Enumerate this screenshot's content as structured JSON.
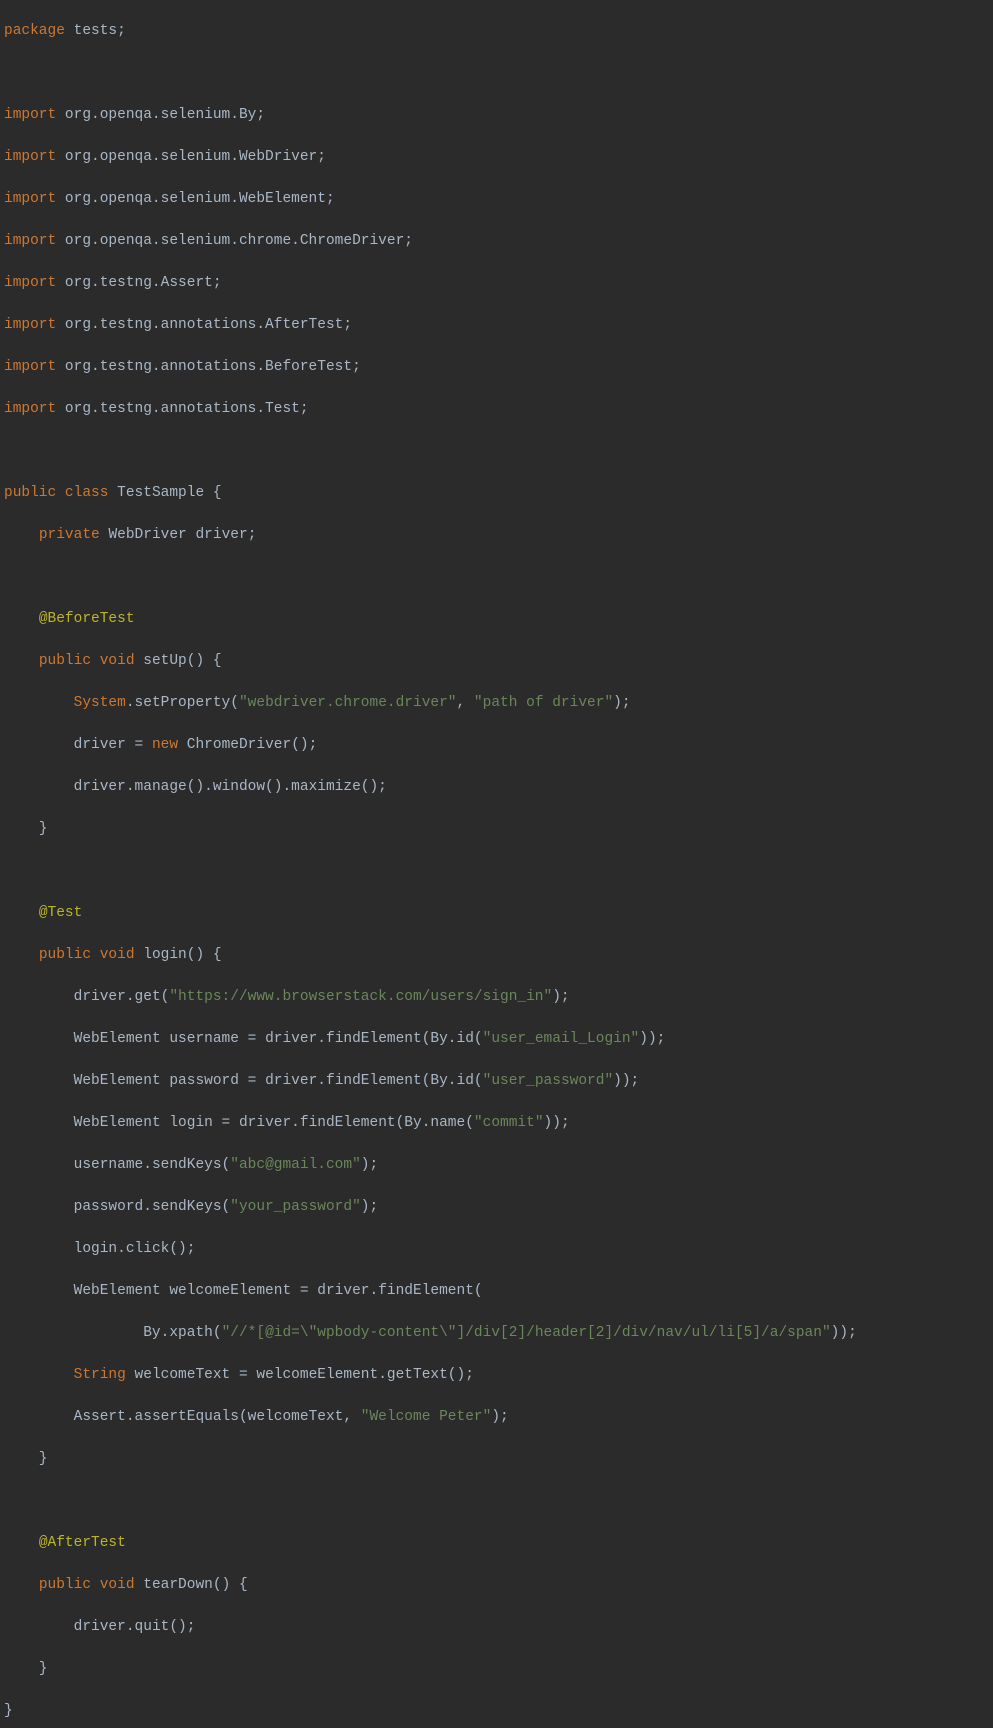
{
  "code": {
    "package_kw": "package",
    "package_name": "tests",
    "import_kw": "import",
    "imports": [
      "org.openqa.selenium.By",
      "org.openqa.selenium.WebDriver",
      "org.openqa.selenium.WebElement",
      "org.openqa.selenium.chrome.ChromeDriver",
      "org.testng.Assert",
      "org.testng.annotations.AfterTest",
      "org.testng.annotations.BeforeTest",
      "org.testng.annotations.Test"
    ],
    "public_kw": "public",
    "class_kw": "class",
    "private_kw": "private",
    "void_kw": "void",
    "new_kw": "new",
    "class_name": "TestSample",
    "field_type": "WebDriver",
    "field_name": "driver",
    "ann_before": "@BeforeTest",
    "ann_test": "@Test",
    "ann_after": "@AfterTest",
    "setup_name": "setUp",
    "login_name": "login",
    "teardown_name": "tearDown",
    "system_cls": "System",
    "string_cls": "String",
    "setProperty": ".setProperty(",
    "webdriver_key": "\"webdriver.chrome.driver\"",
    "driver_path": "\"path of driver\"",
    "chrome_driver": "ChromeDriver",
    "driver_assign": "driver = ",
    "driver_manage": "driver.manage().window().maximize();",
    "driver_get": "driver.get(",
    "url": "\"https://www.browserstack.com/users/sign_in\"",
    "we_type": "WebElement",
    "username_var": "username",
    "password_var": "password",
    "login_var": "login",
    "welcome_var": "welcomeElement",
    "welcometext_var": "welcomeText",
    "find_prefix": "driver.findElement(By.id(",
    "find_name_prefix": "driver.findElement(By.name(",
    "find_plain": "driver.findElement(",
    "by_xpath": "By.xpath(",
    "id_email": "\"user_email_Login\"",
    "id_password": "\"user_password\"",
    "name_commit": "\"commit\"",
    "sendkeys_email": "\"abc@gmail.com\"",
    "sendkeys_pwd": "\"your_password\"",
    "xpath_str": "\"//*[@id=\\\"wpbody-content\\\"]/div[2]/header[2]/div/nav/ul/li[5]/a/span\"",
    "username_send": "username.sendKeys(",
    "password_send": "password.sendKeys(",
    "login_click": "login.click();",
    "gettext": "welcomeElement.getText();",
    "assert_line": "Assert.assertEquals(welcomeText, ",
    "welcome_str": "\"Welcome Peter\"",
    "driver_quit": "driver.quit();"
  }
}
